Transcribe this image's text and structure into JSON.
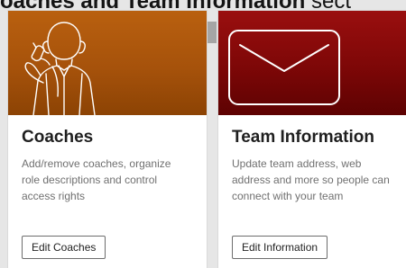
{
  "heading": {
    "bold_text": "oaches and Team Information",
    "tail_text": " sect"
  },
  "cards": {
    "coaches": {
      "title": "Coaches",
      "description": "Add/remove coaches, organize role descriptions and control access rights",
      "button_label": "Edit Coaches",
      "illustration_icon": "coach-whistle-icon",
      "accent_color": "#b9600f"
    },
    "team": {
      "title": "Team Information",
      "description": "Update team address, web address and more so people can connect with your team",
      "button_label": "Edit Information",
      "illustration_icon": "envelope-icon",
      "accent_color": "#9a0f0f"
    }
  }
}
